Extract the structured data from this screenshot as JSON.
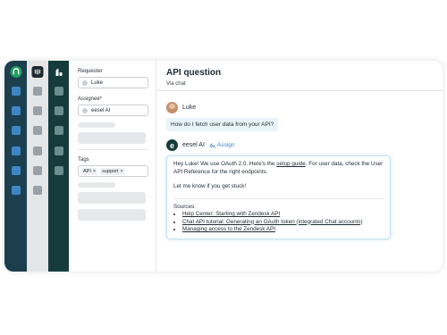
{
  "properties": {
    "requester_label": "Requester",
    "requester_value": "Luke",
    "assignee_label": "Assignee*",
    "assignee_value": "eesel AI",
    "tags_label": "Tags",
    "tags": [
      "API",
      "support"
    ]
  },
  "ticket": {
    "title": "API question",
    "subtitle": "Via chat"
  },
  "customer_message": {
    "author": "Luke",
    "text": "How do I fetch user data from your API?"
  },
  "ai_reply": {
    "author": "eesel AI",
    "assign_label": "Assign",
    "text_before_link": "Hey Luke! We use OAuth 2.0. Here's the ",
    "link_text": "setup guide",
    "text_after_link": ". For user data, check the User API Reference for the right endpoints.",
    "closing": "Let me know if you get stuck!",
    "sources_label": "Sources:",
    "sources": [
      "Help Center: Starting with Zendesk API",
      "Chat API tutorial: Generating an OAuth token (integrated Chat accounts)",
      "Managing access to the Zendesk API"
    ]
  },
  "colors": {
    "rail_1": "#1c3f4e",
    "rail_2": "#e4e6e7",
    "rail_3": "#153c3b",
    "accent": "#3d86c6"
  },
  "icons": [
    "zendesk-logo-icon",
    "intercom-logo-icon",
    "freshdesk-logo-icon",
    "assign-arrow-icon",
    "tag-remove-icon"
  ]
}
